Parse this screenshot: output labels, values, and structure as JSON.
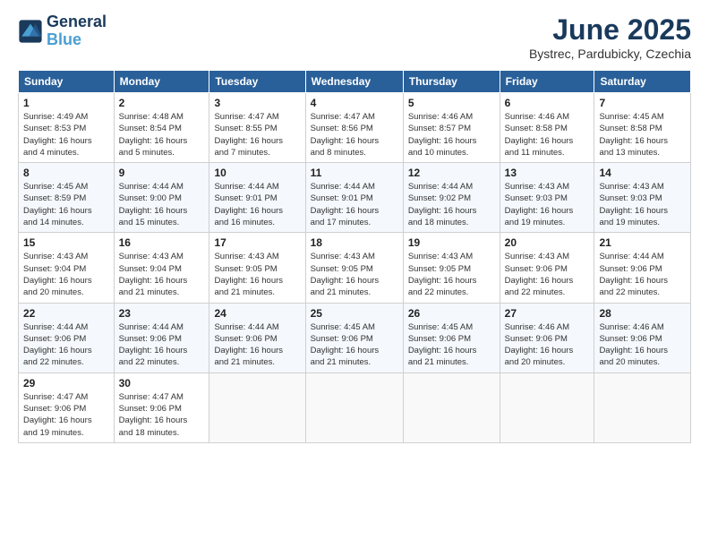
{
  "logo": {
    "line1": "General",
    "line2": "Blue"
  },
  "header": {
    "month_year": "June 2025",
    "location": "Bystrec, Pardubicky, Czechia"
  },
  "days_of_week": [
    "Sunday",
    "Monday",
    "Tuesday",
    "Wednesday",
    "Thursday",
    "Friday",
    "Saturday"
  ],
  "weeks": [
    [
      {
        "day": "1",
        "info": "Sunrise: 4:49 AM\nSunset: 8:53 PM\nDaylight: 16 hours\nand 4 minutes."
      },
      {
        "day": "2",
        "info": "Sunrise: 4:48 AM\nSunset: 8:54 PM\nDaylight: 16 hours\nand 5 minutes."
      },
      {
        "day": "3",
        "info": "Sunrise: 4:47 AM\nSunset: 8:55 PM\nDaylight: 16 hours\nand 7 minutes."
      },
      {
        "day": "4",
        "info": "Sunrise: 4:47 AM\nSunset: 8:56 PM\nDaylight: 16 hours\nand 8 minutes."
      },
      {
        "day": "5",
        "info": "Sunrise: 4:46 AM\nSunset: 8:57 PM\nDaylight: 16 hours\nand 10 minutes."
      },
      {
        "day": "6",
        "info": "Sunrise: 4:46 AM\nSunset: 8:58 PM\nDaylight: 16 hours\nand 11 minutes."
      },
      {
        "day": "7",
        "info": "Sunrise: 4:45 AM\nSunset: 8:58 PM\nDaylight: 16 hours\nand 13 minutes."
      }
    ],
    [
      {
        "day": "8",
        "info": "Sunrise: 4:45 AM\nSunset: 8:59 PM\nDaylight: 16 hours\nand 14 minutes."
      },
      {
        "day": "9",
        "info": "Sunrise: 4:44 AM\nSunset: 9:00 PM\nDaylight: 16 hours\nand 15 minutes."
      },
      {
        "day": "10",
        "info": "Sunrise: 4:44 AM\nSunset: 9:01 PM\nDaylight: 16 hours\nand 16 minutes."
      },
      {
        "day": "11",
        "info": "Sunrise: 4:44 AM\nSunset: 9:01 PM\nDaylight: 16 hours\nand 17 minutes."
      },
      {
        "day": "12",
        "info": "Sunrise: 4:44 AM\nSunset: 9:02 PM\nDaylight: 16 hours\nand 18 minutes."
      },
      {
        "day": "13",
        "info": "Sunrise: 4:43 AM\nSunset: 9:03 PM\nDaylight: 16 hours\nand 19 minutes."
      },
      {
        "day": "14",
        "info": "Sunrise: 4:43 AM\nSunset: 9:03 PM\nDaylight: 16 hours\nand 19 minutes."
      }
    ],
    [
      {
        "day": "15",
        "info": "Sunrise: 4:43 AM\nSunset: 9:04 PM\nDaylight: 16 hours\nand 20 minutes."
      },
      {
        "day": "16",
        "info": "Sunrise: 4:43 AM\nSunset: 9:04 PM\nDaylight: 16 hours\nand 21 minutes."
      },
      {
        "day": "17",
        "info": "Sunrise: 4:43 AM\nSunset: 9:05 PM\nDaylight: 16 hours\nand 21 minutes."
      },
      {
        "day": "18",
        "info": "Sunrise: 4:43 AM\nSunset: 9:05 PM\nDaylight: 16 hours\nand 21 minutes."
      },
      {
        "day": "19",
        "info": "Sunrise: 4:43 AM\nSunset: 9:05 PM\nDaylight: 16 hours\nand 22 minutes."
      },
      {
        "day": "20",
        "info": "Sunrise: 4:43 AM\nSunset: 9:06 PM\nDaylight: 16 hours\nand 22 minutes."
      },
      {
        "day": "21",
        "info": "Sunrise: 4:44 AM\nSunset: 9:06 PM\nDaylight: 16 hours\nand 22 minutes."
      }
    ],
    [
      {
        "day": "22",
        "info": "Sunrise: 4:44 AM\nSunset: 9:06 PM\nDaylight: 16 hours\nand 22 minutes."
      },
      {
        "day": "23",
        "info": "Sunrise: 4:44 AM\nSunset: 9:06 PM\nDaylight: 16 hours\nand 22 minutes."
      },
      {
        "day": "24",
        "info": "Sunrise: 4:44 AM\nSunset: 9:06 PM\nDaylight: 16 hours\nand 21 minutes."
      },
      {
        "day": "25",
        "info": "Sunrise: 4:45 AM\nSunset: 9:06 PM\nDaylight: 16 hours\nand 21 minutes."
      },
      {
        "day": "26",
        "info": "Sunrise: 4:45 AM\nSunset: 9:06 PM\nDaylight: 16 hours\nand 21 minutes."
      },
      {
        "day": "27",
        "info": "Sunrise: 4:46 AM\nSunset: 9:06 PM\nDaylight: 16 hours\nand 20 minutes."
      },
      {
        "day": "28",
        "info": "Sunrise: 4:46 AM\nSunset: 9:06 PM\nDaylight: 16 hours\nand 20 minutes."
      }
    ],
    [
      {
        "day": "29",
        "info": "Sunrise: 4:47 AM\nSunset: 9:06 PM\nDaylight: 16 hours\nand 19 minutes."
      },
      {
        "day": "30",
        "info": "Sunrise: 4:47 AM\nSunset: 9:06 PM\nDaylight: 16 hours\nand 18 minutes."
      },
      {
        "day": "",
        "info": ""
      },
      {
        "day": "",
        "info": ""
      },
      {
        "day": "",
        "info": ""
      },
      {
        "day": "",
        "info": ""
      },
      {
        "day": "",
        "info": ""
      }
    ]
  ]
}
